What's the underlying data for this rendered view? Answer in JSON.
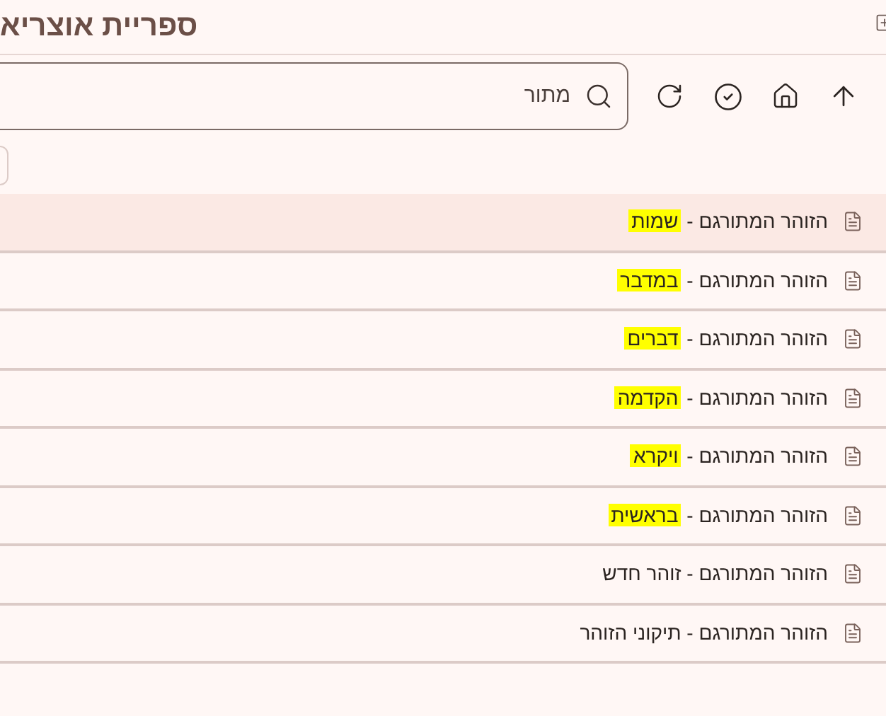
{
  "title": "ספריית אוצריא",
  "search": {
    "placeholder": "מתור"
  },
  "rows": [
    {
      "label": "הזוהר המתורגם -",
      "part": "שמות",
      "selected": true,
      "highlighted": true
    },
    {
      "label": "הזוהר המתורגם -",
      "part": "במדבר",
      "selected": false,
      "highlighted": true
    },
    {
      "label": "הזוהר המתורגם -",
      "part": "דברים",
      "selected": false,
      "highlighted": true
    },
    {
      "label": "הזוהר המתורגם -",
      "part": "הקדמה",
      "selected": false,
      "highlighted": true
    },
    {
      "label": "הזוהר המתורגם -",
      "part": "ויקרא",
      "selected": false,
      "highlighted": true
    },
    {
      "label": "הזוהר המתורגם -",
      "part": "בראשית",
      "selected": false,
      "highlighted": true
    },
    {
      "label": "הזוהר המתורגם -",
      "part": "זוהר חדש",
      "selected": false,
      "highlighted": false
    },
    {
      "label": "הזוהר המתורגם -",
      "part": "תיקוני הזוהר",
      "selected": false,
      "highlighted": false
    }
  ]
}
